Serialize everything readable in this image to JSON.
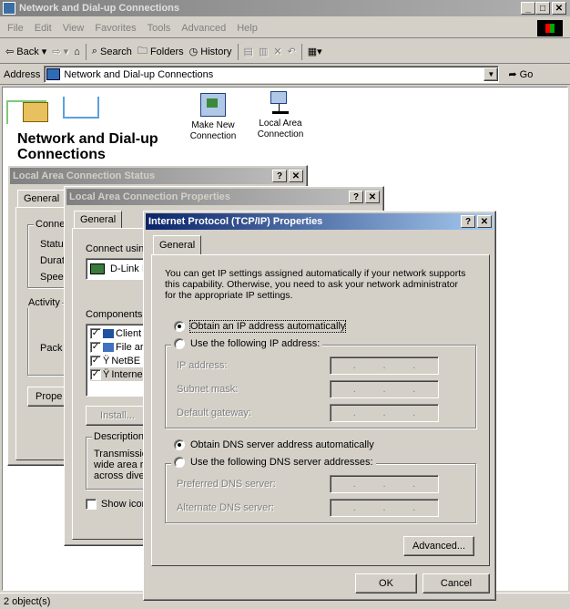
{
  "window": {
    "title": "Network and Dial-up Connections"
  },
  "menu": [
    "File",
    "Edit",
    "View",
    "Favorites",
    "Tools",
    "Advanced",
    "Help"
  ],
  "toolbar": {
    "back": "Back",
    "search": "Search",
    "folders": "Folders",
    "history": "History"
  },
  "address": {
    "label": "Address",
    "value": "Network and Dial-up Connections",
    "go": "Go"
  },
  "folder": {
    "heading": "Network and Dial-up Connections",
    "icons": [
      {
        "label": "Make New Connection"
      },
      {
        "label": "Local Area Connection"
      }
    ]
  },
  "status_dialog": {
    "title": "Local Area Connection Status",
    "tab": "General",
    "partial": {
      "conne": "Conne",
      "statu": "Statu",
      "dura": "Durat",
      "spee": "Spee",
      "activity": "Activity",
      "pack": "Pack",
      "prope": "Prope"
    }
  },
  "props_dialog": {
    "title": "Local Area Connection Properties",
    "tab": "General",
    "connect_using": "Connect using",
    "adapter": "D-Link I",
    "components_label": "Components c",
    "components": [
      "Client",
      "File ar",
      "NetBE",
      "Interne"
    ],
    "install": "Install...",
    "description_label": "Description",
    "description_lines": [
      "Transmissic",
      "wide area r",
      "across dive"
    ],
    "show_icon": "Show icon"
  },
  "tcpip_dialog": {
    "title": "Internet Protocol (TCP/IP) Properties",
    "tab": "General",
    "intro": "You can get IP settings assigned automatically if your network supports this capability. Otherwise, you need to ask your network administrator for the appropriate IP settings.",
    "ip_auto": "Obtain an IP address automatically",
    "ip_manual": "Use the following IP address:",
    "ip_address": "IP address:",
    "subnet": "Subnet mask:",
    "gateway": "Default gateway:",
    "dns_auto": "Obtain DNS server address automatically",
    "dns_manual": "Use the following DNS server addresses:",
    "dns_pref": "Preferred DNS server:",
    "dns_alt": "Alternate DNS server:",
    "advanced": "Advanced...",
    "ok": "OK",
    "cancel": "Cancel"
  },
  "statusbar": {
    "text": "2 object(s)"
  }
}
